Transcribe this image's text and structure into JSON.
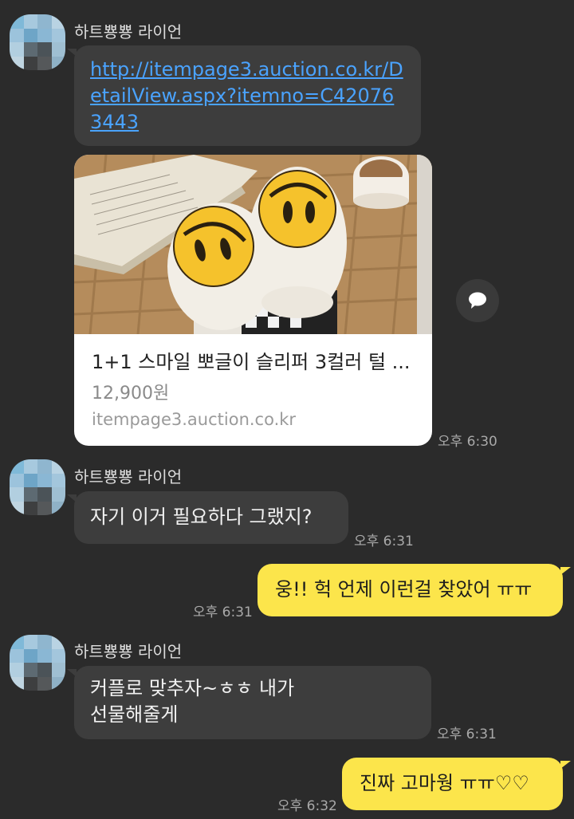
{
  "chat": {
    "messages": [
      {
        "sender": "하트뿅뿅 라이언",
        "link_text": "http://itempage3.auction.co.kr/DetailView.aspx?itemno=C420763443"
      },
      {
        "card": {
          "title": "1+1 스마일 뽀글이 슬리퍼 3컬러 털 ...",
          "price": "12,900원",
          "domain": "itempage3.auction.co.kr"
        },
        "time": "오후 6:30"
      },
      {
        "sender": "하트뿅뿅 라이언",
        "text": "자기 이거 필요하다 그랬지?",
        "time": "오후 6:31"
      },
      {
        "text": "웅!! 헉 언제 이런걸 찾았어 ㅠㅠ",
        "time": "오후 6:31"
      },
      {
        "sender": "하트뿅뿅 라이언",
        "text_line1": "커플로 맞추자~ㅎㅎ 내가",
        "text_line2": "선물해줄게",
        "time": "오후 6:31"
      },
      {
        "text": "진짜 고마웡 ㅠㅠ♡♡",
        "time": "오후 6:32"
      }
    ]
  },
  "icons": {
    "share": "share-icon",
    "avatar": "avatar"
  },
  "colors": {
    "background": "#2b2b2b",
    "incoming_bubble": "#3d3d3d",
    "outgoing_bubble": "#fce54b",
    "link": "#4aa3ff"
  }
}
